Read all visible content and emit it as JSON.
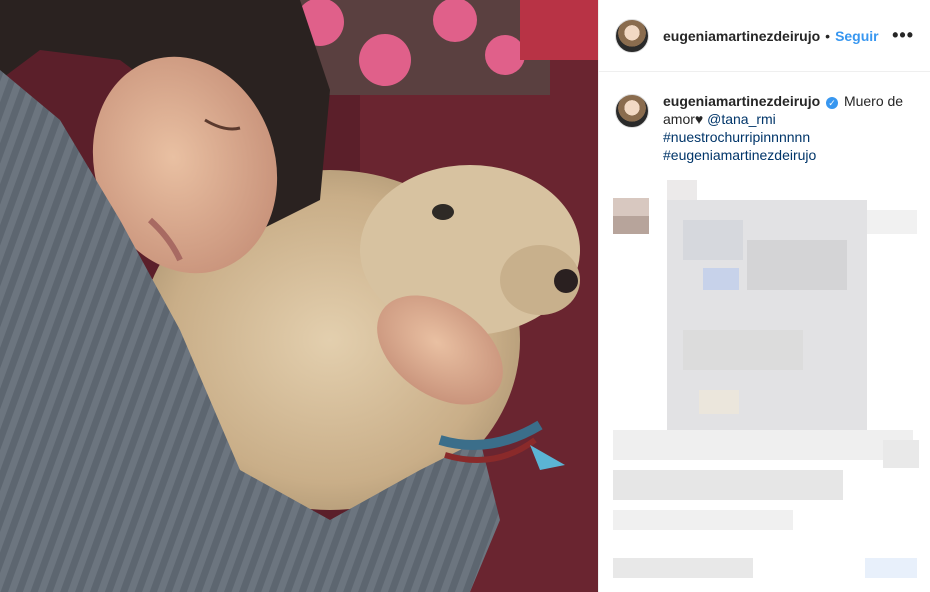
{
  "post": {
    "username": "eugeniamartinezdeirujo",
    "follow_label": "Seguir",
    "separator": "•",
    "more_label": "•••"
  },
  "caption": {
    "username": "eugeniamartinezdeirujo",
    "verified_mark": "✓",
    "text": "Muero de amor♥",
    "mention": "@tana_rmi",
    "hashtag1": "#nuestrochurripinnnnnn",
    "hashtag2": "#eugeniamartinezdeirujo"
  },
  "colors": {
    "follow": "#3897f0",
    "link": "#003569",
    "verified": "#3897f0"
  },
  "icons": {
    "more": "more-options-icon",
    "verified": "verified-badge-icon"
  }
}
